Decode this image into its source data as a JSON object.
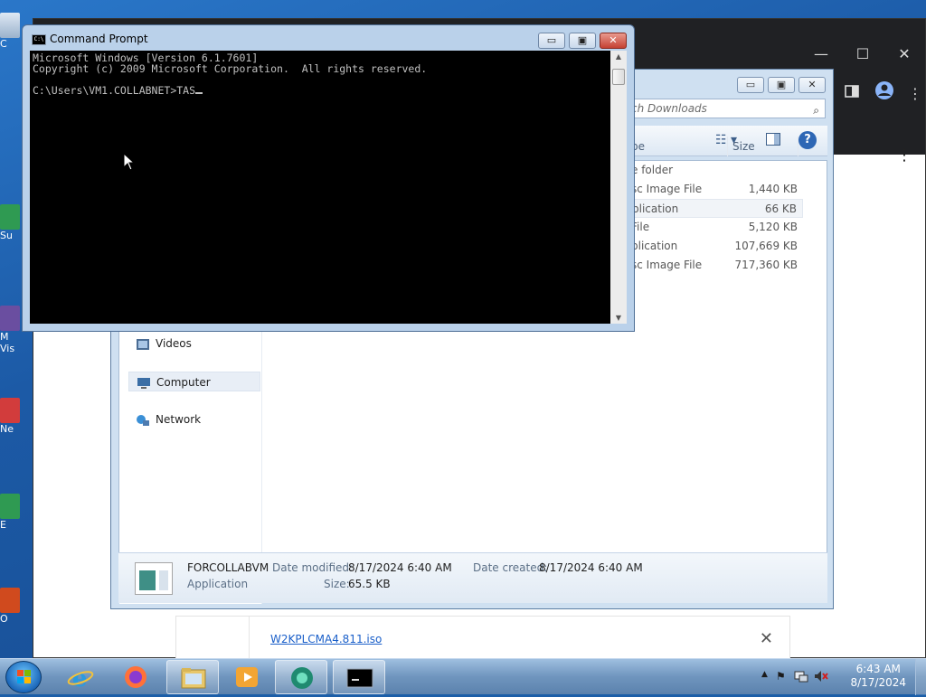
{
  "colors": {
    "desktop": "#1c5aa6",
    "console_bg": "#000000",
    "console_fg": "#c0c0c0",
    "link": "#1a5fc9",
    "chrome_dark": "#202124"
  },
  "desktop": {
    "icons": [
      {
        "label": "C",
        "icon": "recycle-bin-icon"
      },
      {
        "label": "Su",
        "icon": "app-icon"
      },
      {
        "label": "M",
        "icon": "app-icon"
      },
      {
        "label": "Vis",
        "icon": "app-icon"
      },
      {
        "label": "Ne",
        "icon": "app-icon"
      },
      {
        "label": "E",
        "icon": "app-icon"
      },
      {
        "label": "O",
        "icon": "app-icon"
      }
    ]
  },
  "browser": {
    "window_controls": {
      "minimize": "—",
      "maximize": "☐",
      "close": "✕"
    },
    "menu_icon": "⋮"
  },
  "download_bar": {
    "file_link": "W2KPLCMA4.811.iso",
    "close": "✕"
  },
  "explorer": {
    "window_controls": {
      "minimize": "▭",
      "maximize": "▣",
      "close": "✕"
    },
    "search_placeholder": "ch Downloads",
    "columns": {
      "type": "pe",
      "size": "Size"
    },
    "nav": [
      {
        "label": "Videos",
        "icon": "video-library-icon"
      },
      {
        "label": "Computer",
        "icon": "computer-icon"
      },
      {
        "label": "Network",
        "icon": "network-icon"
      }
    ],
    "files": [
      {
        "type": "e folder",
        "size": ""
      },
      {
        "type": "sc Image File",
        "size": "1,440 KB"
      },
      {
        "type": "plication",
        "size": "66 KB"
      },
      {
        "type": "File",
        "size": "5,120 KB"
      },
      {
        "type": "plication",
        "size": "107,669 KB"
      },
      {
        "type": "sc Image File",
        "size": "717,360 KB"
      }
    ],
    "details": {
      "name": "FORCOLLABVM",
      "kind": "Application",
      "modified_label": "Date modified:",
      "modified": "8/17/2024 6:40 AM",
      "created_label": "Date created:",
      "created": "8/17/2024 6:40 AM",
      "size_label": "Size:",
      "size": "65.5 KB"
    }
  },
  "cmd": {
    "title": "Command Prompt",
    "icon_text": "C:\\",
    "window_controls": {
      "minimize": "▭",
      "maximize": "▣",
      "close": "✕"
    },
    "lines": [
      "Microsoft Windows [Version 6.1.7601]",
      "Copyright (c) 2009 Microsoft Corporation.  All rights reserved.",
      "",
      "C:\\Users\\VM1.COLLABNET>TAS"
    ]
  },
  "taskbar": {
    "apps": [
      {
        "name": "internet-explorer",
        "icon": "internet-explorer-icon"
      },
      {
        "name": "firefox",
        "icon": "firefox-icon"
      },
      {
        "name": "explorer",
        "icon": "folder-icon"
      },
      {
        "name": "media-player",
        "icon": "media-player-icon"
      },
      {
        "name": "collabvm",
        "icon": "collabvm-icon"
      },
      {
        "name": "command-prompt",
        "icon": "command-prompt-icon"
      }
    ],
    "tray": {
      "expand": "▲",
      "flag": "⚑",
      "time": "6:43 AM",
      "date": "8/17/2024"
    }
  }
}
